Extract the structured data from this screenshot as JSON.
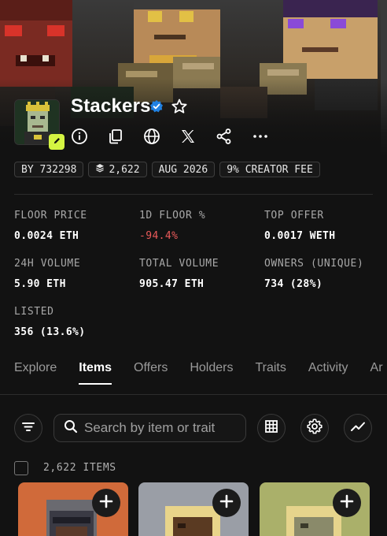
{
  "collection": {
    "name": "Stackers",
    "verified": true
  },
  "header_icons": [
    "info-icon",
    "copy-icon",
    "globe-icon",
    "x-logo-icon",
    "share-icon",
    "more-icon"
  ],
  "chips": [
    {
      "label": "BY 732298"
    },
    {
      "label": "2,622",
      "icon": "layers-icon"
    },
    {
      "label": "AUG 2026"
    },
    {
      "label": "9% CREATOR FEE"
    }
  ],
  "stats": {
    "floor_price": {
      "label": "FLOOR PRICE",
      "value": "0.0024 ETH"
    },
    "floor_change": {
      "label": "1D FLOOR %",
      "value": "-94.4%"
    },
    "top_offer": {
      "label": "TOP OFFER",
      "value": "0.0017 WETH"
    },
    "volume_24h": {
      "label": "24H VOLUME",
      "value": "5.90 ETH"
    },
    "total_volume": {
      "label": "TOTAL VOLUME",
      "value": "905.47 ETH"
    },
    "owners": {
      "label": "OWNERS (UNIQUE)",
      "value": "734 (28%)"
    },
    "listed": {
      "label": "LISTED",
      "value": "356 (13.6%)"
    }
  },
  "tabs": [
    {
      "label": "Explore",
      "active": false
    },
    {
      "label": "Items",
      "active": true
    },
    {
      "label": "Offers",
      "active": false
    },
    {
      "label": "Holders",
      "active": false
    },
    {
      "label": "Traits",
      "active": false
    },
    {
      "label": "Activity",
      "active": false
    },
    {
      "label": "Ar",
      "active": false
    }
  ],
  "search": {
    "placeholder": "Search by item or trait"
  },
  "items_count": "2,622 ITEMS",
  "colors": {
    "accent_badge": "#d4f542",
    "verified": "#2081e2",
    "negative": "#ea5a5a",
    "card_1": "#d06a3a",
    "card_2": "#9a9ea6",
    "card_3": "#aab06a"
  }
}
